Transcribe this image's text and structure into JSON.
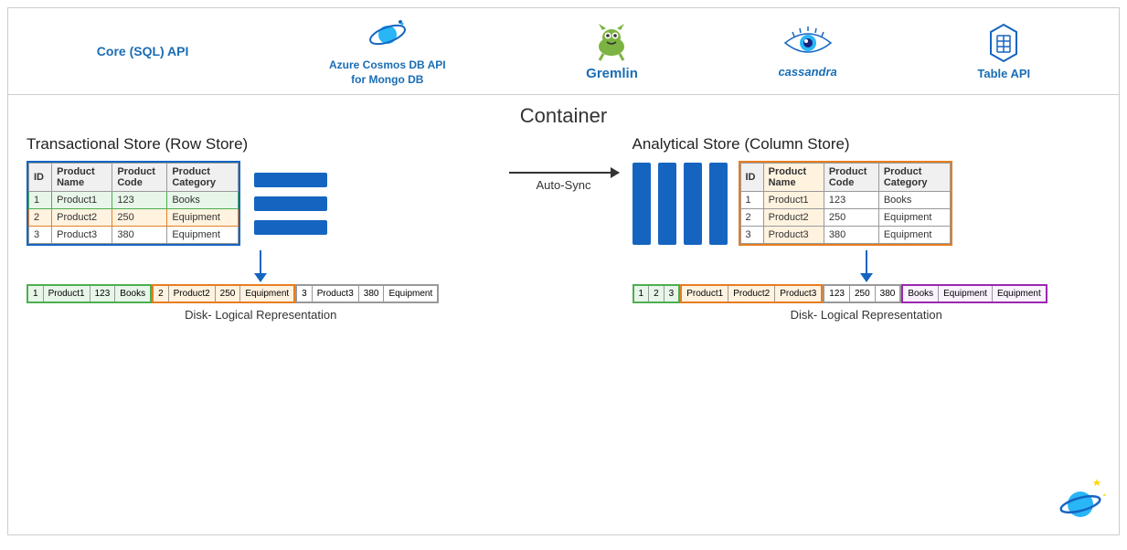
{
  "header": {
    "apis": [
      {
        "id": "sql",
        "label": "Core (SQL) API",
        "hasIcon": false
      },
      {
        "id": "cosmos",
        "label": "Azure Cosmos DB API\nfor Mongo DB",
        "hasIcon": true
      },
      {
        "id": "gremlin",
        "label": "Gremlin",
        "hasIcon": true
      },
      {
        "id": "cassandra",
        "label": "cassandra",
        "hasIcon": true
      },
      {
        "id": "table",
        "label": "Table API",
        "hasIcon": true
      }
    ]
  },
  "main": {
    "container_title": "Container",
    "transactional": {
      "title": "Transactional Store (Row Store)",
      "table": {
        "headers": [
          "ID",
          "Product\nName",
          "Product\nCode",
          "Product\nCategory"
        ],
        "rows": [
          {
            "id": "1",
            "name": "Product1",
            "code": "123",
            "category": "Books",
            "style": "green"
          },
          {
            "id": "2",
            "name": "Product2",
            "code": "250",
            "category": "Equipment",
            "style": "orange"
          },
          {
            "id": "3",
            "name": "Product3",
            "code": "380",
            "category": "Equipment",
            "style": "gray"
          }
        ]
      },
      "disk_label": "Disk- Logical Representation",
      "disk_cells_row1": [
        "1",
        "Product1",
        "123",
        "Books"
      ],
      "disk_cells_row2": [
        "2",
        "Product2",
        "250",
        "Equipment"
      ],
      "disk_cells_row3": [
        "3",
        "Product3",
        "380",
        "Equipment"
      ]
    },
    "autosync": "Auto-Sync",
    "analytical": {
      "title": "Analytical Store (Column Store)",
      "table": {
        "headers": [
          "ID",
          "Product\nName",
          "Product\nCode",
          "Product\nCategory"
        ],
        "rows": [
          {
            "id": "1",
            "name": "Product1",
            "code": "123",
            "category": "Books"
          },
          {
            "id": "2",
            "name": "Product2",
            "code": "250",
            "category": "Equipment"
          },
          {
            "id": "3",
            "name": "Product3",
            "code": "380",
            "category": "Equipment"
          }
        ]
      },
      "disk_label": "Disk- Logical Representation",
      "disk_ids": [
        "1",
        "2",
        "3"
      ],
      "disk_names": [
        "Product1",
        "Product2",
        "Product3"
      ],
      "disk_codes": [
        "123",
        "250",
        "380"
      ],
      "disk_cats": [
        "Books",
        "Equipment",
        "Equipment"
      ]
    }
  },
  "colors": {
    "blue": "#1565c0",
    "green": "#4caf50",
    "orange": "#e67e22",
    "accent_blue": "#1a6db5"
  }
}
